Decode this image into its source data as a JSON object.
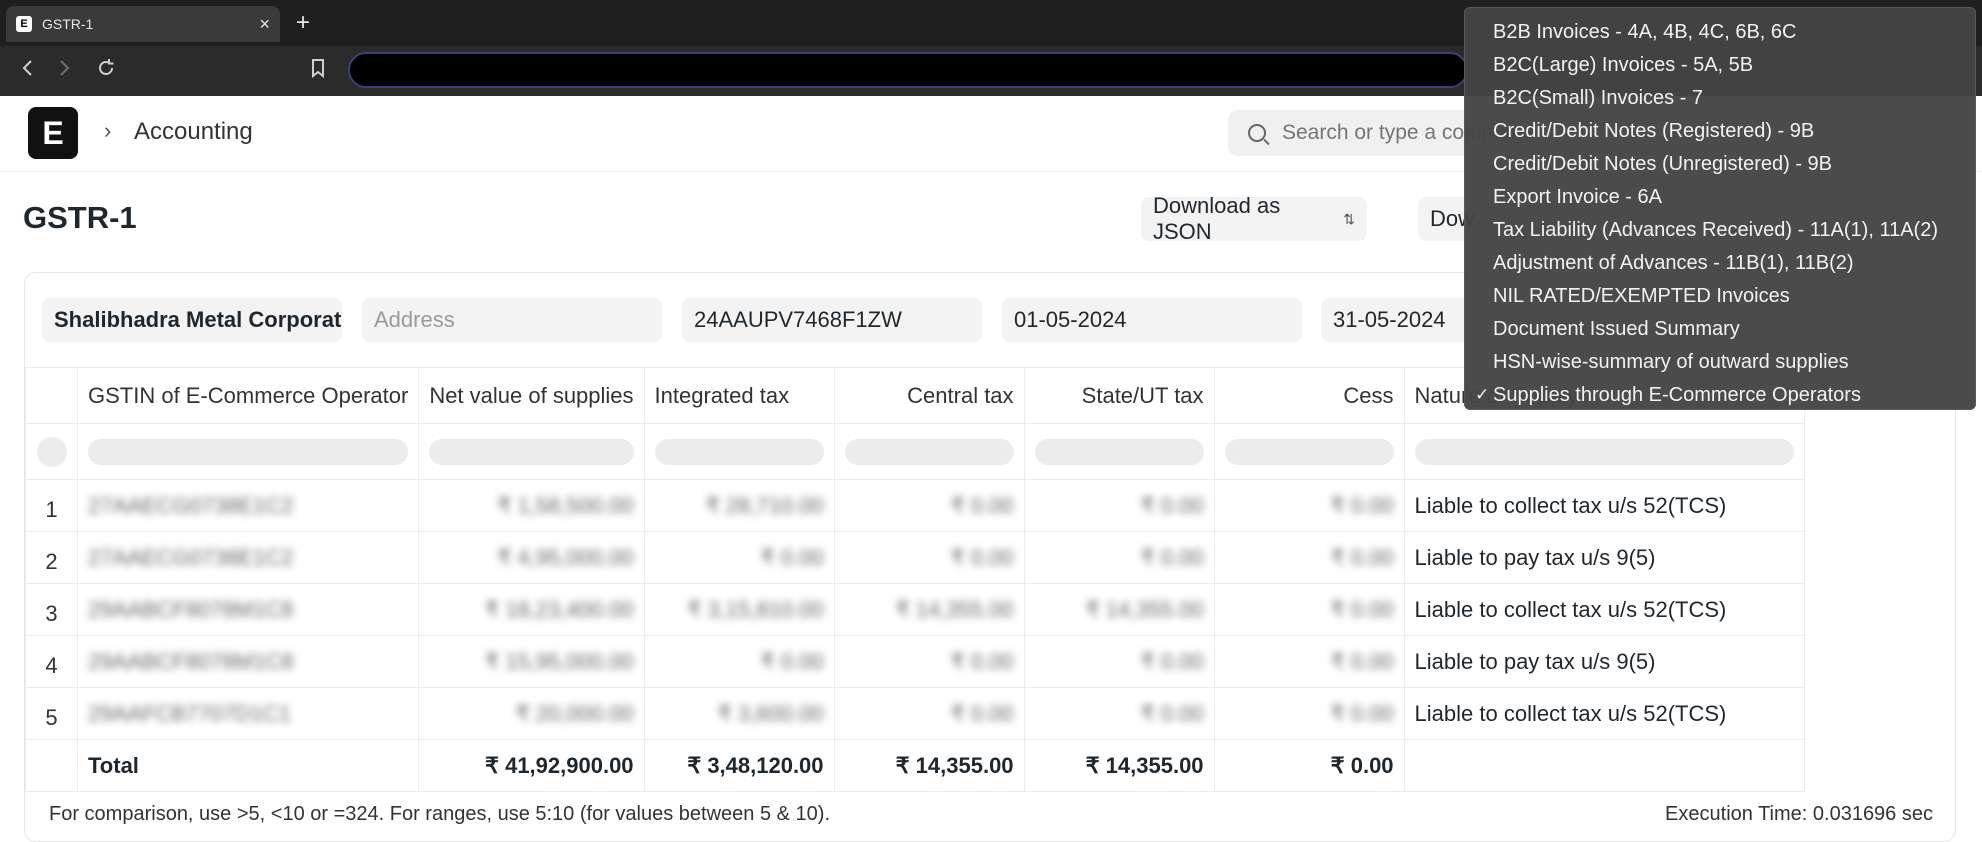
{
  "browser": {
    "tab_title": "GSTR-1",
    "tab_favicon": "E",
    "close_glyph": "×",
    "new_tab_glyph": "+"
  },
  "app": {
    "logo_letter": "E",
    "breadcrumb": "Accounting",
    "search_placeholder": "Search or type a command"
  },
  "page": {
    "title": "GSTR-1",
    "download_json_label": "Download as JSON",
    "download_other_label": "Dow"
  },
  "filters": {
    "company": "Shalibhadra Metal Corporation",
    "address_placeholder": "Address",
    "gstin": "24AAUPV7468F1ZW",
    "from_date": "01-05-2024",
    "to_date": "31-05-2024"
  },
  "table": {
    "columns": [
      "GSTIN of E-Commerce Operator",
      "Net value of supplies",
      "Integrated tax",
      "Central tax",
      "State/UT tax",
      "Cess",
      "Nature of Supply"
    ],
    "rows": [
      {
        "num": "1",
        "gstin": "27AAECG0738E1C2",
        "net": "₹ 1,58,500.00",
        "igst": "₹ 28,710.00",
        "cgst": "₹ 0.00",
        "sgst": "₹ 0.00",
        "cess": "₹ 0.00",
        "nature": "Liable to collect tax u/s 52(TCS)"
      },
      {
        "num": "2",
        "gstin": "27AAECG0738E1C2",
        "net": "₹ 4,95,000.00",
        "igst": "₹ 0.00",
        "cgst": "₹ 0.00",
        "sgst": "₹ 0.00",
        "cess": "₹ 0.00",
        "nature": "Liable to pay tax u/s 9(5)"
      },
      {
        "num": "3",
        "gstin": "29AABCF8078M1C8",
        "net": "₹ 18,23,400.00",
        "igst": "₹ 3,15,810.00",
        "cgst": "₹ 14,355.00",
        "sgst": "₹ 14,355.00",
        "cess": "₹ 0.00",
        "nature": "Liable to collect tax u/s 52(TCS)"
      },
      {
        "num": "4",
        "gstin": "29AABCF8078M1C8",
        "net": "₹ 15,95,000.00",
        "igst": "₹ 0.00",
        "cgst": "₹ 0.00",
        "sgst": "₹ 0.00",
        "cess": "₹ 0.00",
        "nature": "Liable to pay tax u/s 9(5)"
      },
      {
        "num": "5",
        "gstin": "29AAFCB7707D1C1",
        "net": "₹ 20,000.00",
        "igst": "₹ 3,600.00",
        "cgst": "₹ 0.00",
        "sgst": "₹ 0.00",
        "cess": "₹ 0.00",
        "nature": "Liable to collect tax u/s 52(TCS)"
      }
    ],
    "total": {
      "label": "Total",
      "net": "₹ 41,92,900.00",
      "igst": "₹ 3,48,120.00",
      "cgst": "₹ 14,355.00",
      "sgst": "₹ 14,355.00",
      "cess": "₹ 0.00"
    }
  },
  "footer": {
    "hint": "For comparison, use >5, <10 or =324. For ranges, use 5:10 (for values between 5 & 10).",
    "execution_time": "Execution Time: 0.031696 sec"
  },
  "dropdown": {
    "check_glyph": "✓",
    "options": [
      "B2B Invoices - 4A, 4B, 4C, 6B, 6C",
      "B2C(Large) Invoices - 5A, 5B",
      "B2C(Small) Invoices - 7",
      "Credit/Debit Notes (Registered) - 9B",
      "Credit/Debit Notes (Unregistered) - 9B",
      "Export Invoice - 6A",
      "Tax Liability (Advances Received) - 11A(1), 11A(2)",
      "Adjustment of Advances - 11B(1), 11B(2)",
      "NIL RATED/EXEMPTED Invoices",
      "Document Issued Summary",
      "HSN-wise-summary of outward supplies",
      "Supplies through E-Commerce Operators"
    ],
    "selected_index": 11
  },
  "icons": {
    "back": "back-arrow-icon",
    "forward": "forward-arrow-icon",
    "reload": "reload-icon",
    "bookmark": "bookmark-icon",
    "search": "search-icon",
    "chevron": "chevron-right-icon"
  }
}
